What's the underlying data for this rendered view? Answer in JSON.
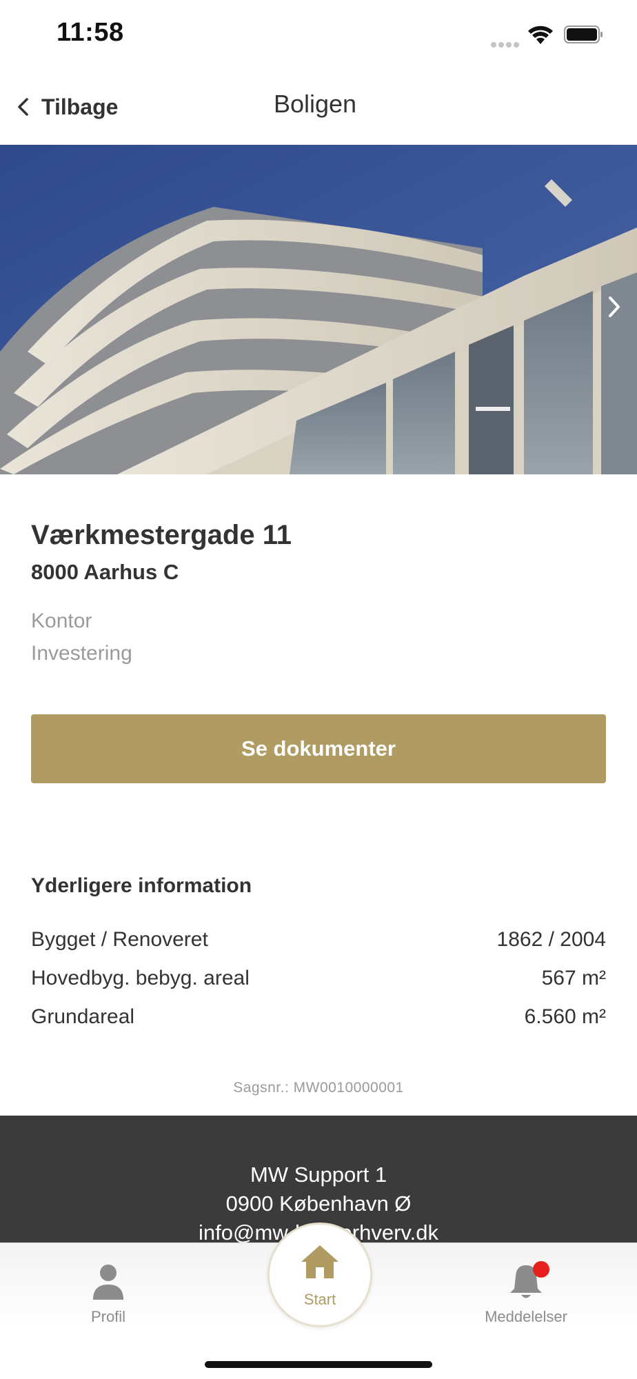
{
  "status_bar": {
    "time": "11:58"
  },
  "header": {
    "back_label": "Tilbage",
    "title": "Boligen"
  },
  "property": {
    "street": "Værkmestergade 11",
    "city": "8000 Aarhus C",
    "categories": [
      "Kontor",
      "Investering"
    ],
    "documents_button": "Se dokumenter"
  },
  "info": {
    "title": "Yderligere information",
    "rows": [
      {
        "label": "Bygget / Renoveret",
        "value": "1862 / 2004"
      },
      {
        "label": "Hovedbyg. bebyg. areal",
        "value": "567 m²"
      },
      {
        "label": "Grundareal",
        "value": "6.560 m²"
      }
    ]
  },
  "case_number": "Sagsnr.: MW0010000001",
  "footer": {
    "lines": [
      "MW Support 1",
      "0900 København Ø",
      "info@mw-boligerhverv.dk"
    ]
  },
  "tabs": [
    {
      "label": "Profil",
      "icon": "person-icon"
    },
    {
      "label": "Start",
      "icon": "home-icon"
    },
    {
      "label": "Meddelelser",
      "icon": "bell-icon"
    }
  ],
  "colors": {
    "accent": "#b09b62",
    "footer_bg": "#3b3b3b",
    "notification_badge": "#e8201d",
    "muted_text": "#9a9a9a"
  }
}
